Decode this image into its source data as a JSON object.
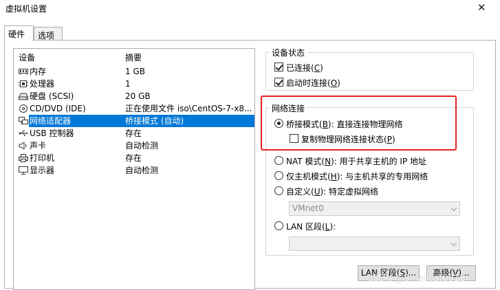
{
  "window": {
    "title": "虚拟机设置",
    "close_glyph": "✕"
  },
  "tabs": [
    {
      "label": "硬件"
    },
    {
      "label": "选项"
    }
  ],
  "device_list": {
    "col_device": "设备",
    "col_summary": "摘要",
    "rows": [
      {
        "name": "内存",
        "summary": "1 GB",
        "icon": "memory-icon"
      },
      {
        "name": "处理器",
        "summary": "1",
        "icon": "processor-icon"
      },
      {
        "name": "硬盘 (SCSI)",
        "summary": "20 GB",
        "icon": "hard-disk-icon"
      },
      {
        "name": "CD/DVD (IDE)",
        "summary": "正在使用文件 iso\\CentOS-7-x8...",
        "icon": "cd-dvd-icon"
      },
      {
        "name": "网络适配器",
        "summary": "桥接模式 (自动)",
        "icon": "network-adapter-icon",
        "selected": true
      },
      {
        "name": "USB 控制器",
        "summary": "存在",
        "icon": "usb-icon"
      },
      {
        "name": "声卡",
        "summary": "自动检测",
        "icon": "speaker-icon"
      },
      {
        "name": "打印机",
        "summary": "存在",
        "icon": "printer-icon"
      },
      {
        "name": "显示器",
        "summary": "自动检测",
        "icon": "monitor-icon"
      }
    ]
  },
  "device_status": {
    "title": "设备状态",
    "connected": {
      "pre": "已连接(",
      "key": "C",
      "post": ")",
      "checked": true
    },
    "connect_at_power_on": {
      "pre": "启动时连接(",
      "key": "O",
      "post": ")",
      "checked": true
    }
  },
  "network": {
    "title": "网络连接",
    "bridged": {
      "pre": "桥接模式(",
      "key": "B",
      "post": "): 直接连接物理网络",
      "selected": true
    },
    "replicate": {
      "pre": "复制物理网络连接状态(",
      "key": "P",
      "post": ")",
      "checked": false
    },
    "nat": {
      "pre": "NAT 模式(",
      "key": "N",
      "post": "): 用于共享主机的 IP 地址"
    },
    "host_only": {
      "pre": "仅主机模式(",
      "key": "H",
      "post": "): 与主机共享的专用网络"
    },
    "custom": {
      "pre": "自定义(",
      "key": "U",
      "post": "): 特定虚拟网络"
    },
    "custom_select_value": "VMnet0",
    "lan_segment": {
      "pre": "LAN 区段(",
      "key": "L",
      "post": "):"
    },
    "lan_select_value": ""
  },
  "buttons": {
    "lan_segments": {
      "pre": "LAN 区段(",
      "key": "S",
      "post": ")..."
    },
    "advanced": {
      "pre": "高级(",
      "key": "V",
      "post": ")..."
    }
  },
  "watermark": "CSDN @Smallcat0912",
  "colors": {
    "selection": "#0078d7",
    "highlight_box": "#e41e1e"
  }
}
